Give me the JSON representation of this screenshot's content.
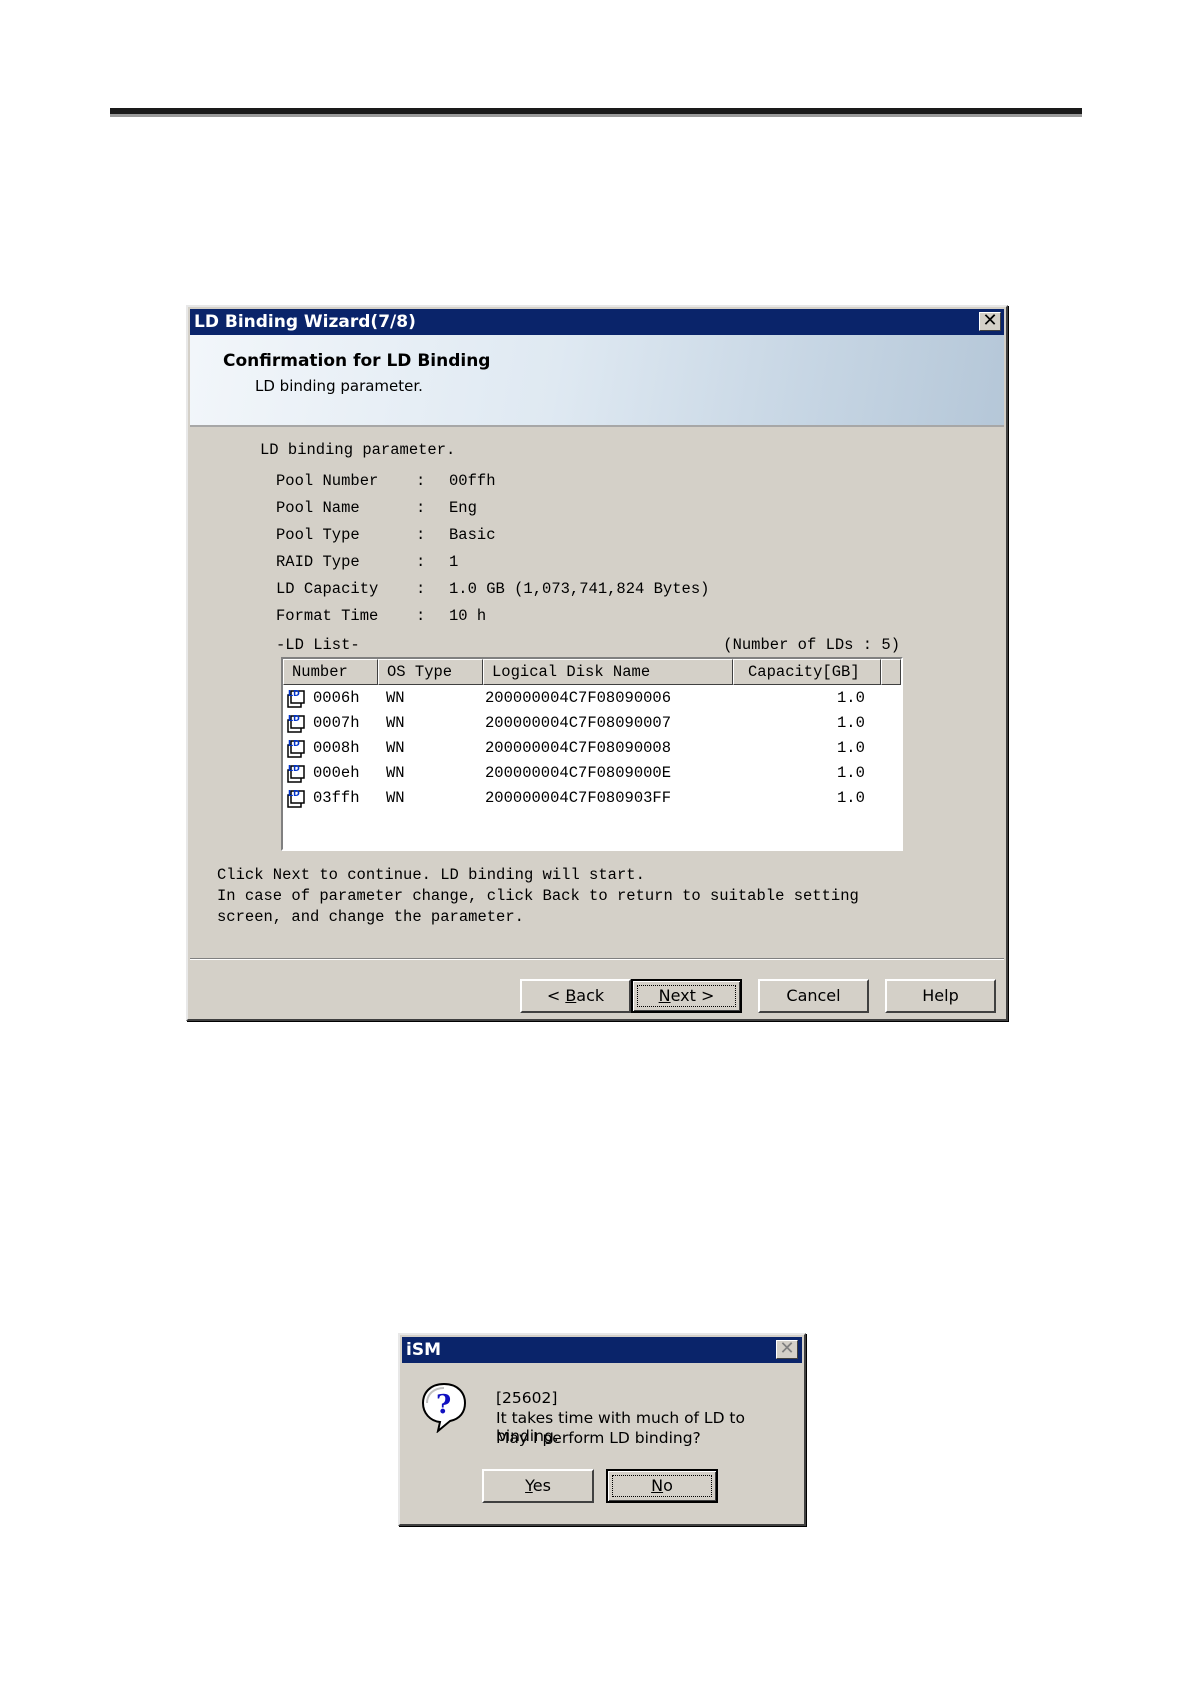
{
  "wizard": {
    "title": "LD Binding Wizard(7/8)",
    "close_glyph": "✕",
    "banner_title": "Confirmation for LD Binding",
    "banner_subtitle": "LD binding parameter.",
    "params_heading": "LD binding parameter.",
    "params": [
      {
        "label": "Pool Number",
        "sep": ":",
        "value": "00ffh"
      },
      {
        "label": "Pool Name",
        "sep": ":",
        "value": "Eng"
      },
      {
        "label": "Pool Type",
        "sep": ":",
        "value": "Basic"
      },
      {
        "label": "RAID Type",
        "sep": ":",
        "value": "1"
      },
      {
        "label": "LD Capacity",
        "sep": ":",
        "value": "1.0 GB (1,073,741,824 Bytes)"
      },
      {
        "label": "Format Time",
        "sep": ":",
        "value": "10 h"
      }
    ],
    "ld_list_caption": "-LD List-",
    "ld_count": "(Number of LDs : 5)",
    "columns": [
      "Number",
      "OS Type",
      "Logical Disk Name",
      "Capacity[GB]"
    ],
    "rows": [
      {
        "number": "0006h",
        "os_type": "WN",
        "name": "200000004C7F08090006",
        "capacity": "1.0"
      },
      {
        "number": "0007h",
        "os_type": "WN",
        "name": "200000004C7F08090007",
        "capacity": "1.0"
      },
      {
        "number": "0008h",
        "os_type": "WN",
        "name": "200000004C7F08090008",
        "capacity": "1.0"
      },
      {
        "number": "000eh",
        "os_type": "WN",
        "name": "200000004C7F0809000E",
        "capacity": "1.0"
      },
      {
        "number": "03ffh",
        "os_type": "WN",
        "name": "200000004C7F080903FF",
        "capacity": "1.0"
      }
    ],
    "notes": [
      "Click Next to continue. LD binding will start.",
      "In case of parameter change, click Back to return to suitable setting",
      "screen, and change the parameter."
    ],
    "buttons": {
      "back_arrow": "< ",
      "back_mnemonic": "B",
      "back_rest": "ack",
      "next_mnemonic": "N",
      "next_rest": "ext",
      "next_arrow": " >",
      "cancel": "Cancel",
      "help": "Help"
    }
  },
  "message_box": {
    "title": "iSM",
    "close_glyph": "✕",
    "icon": "question-icon",
    "code": "[25602]",
    "line1": "It takes time with much of LD to binding.",
    "line2": "May I perform LD binding?",
    "yes_mnemonic": "Y",
    "yes_rest": "es",
    "no_mnemonic": "N",
    "no_rest": "o"
  }
}
